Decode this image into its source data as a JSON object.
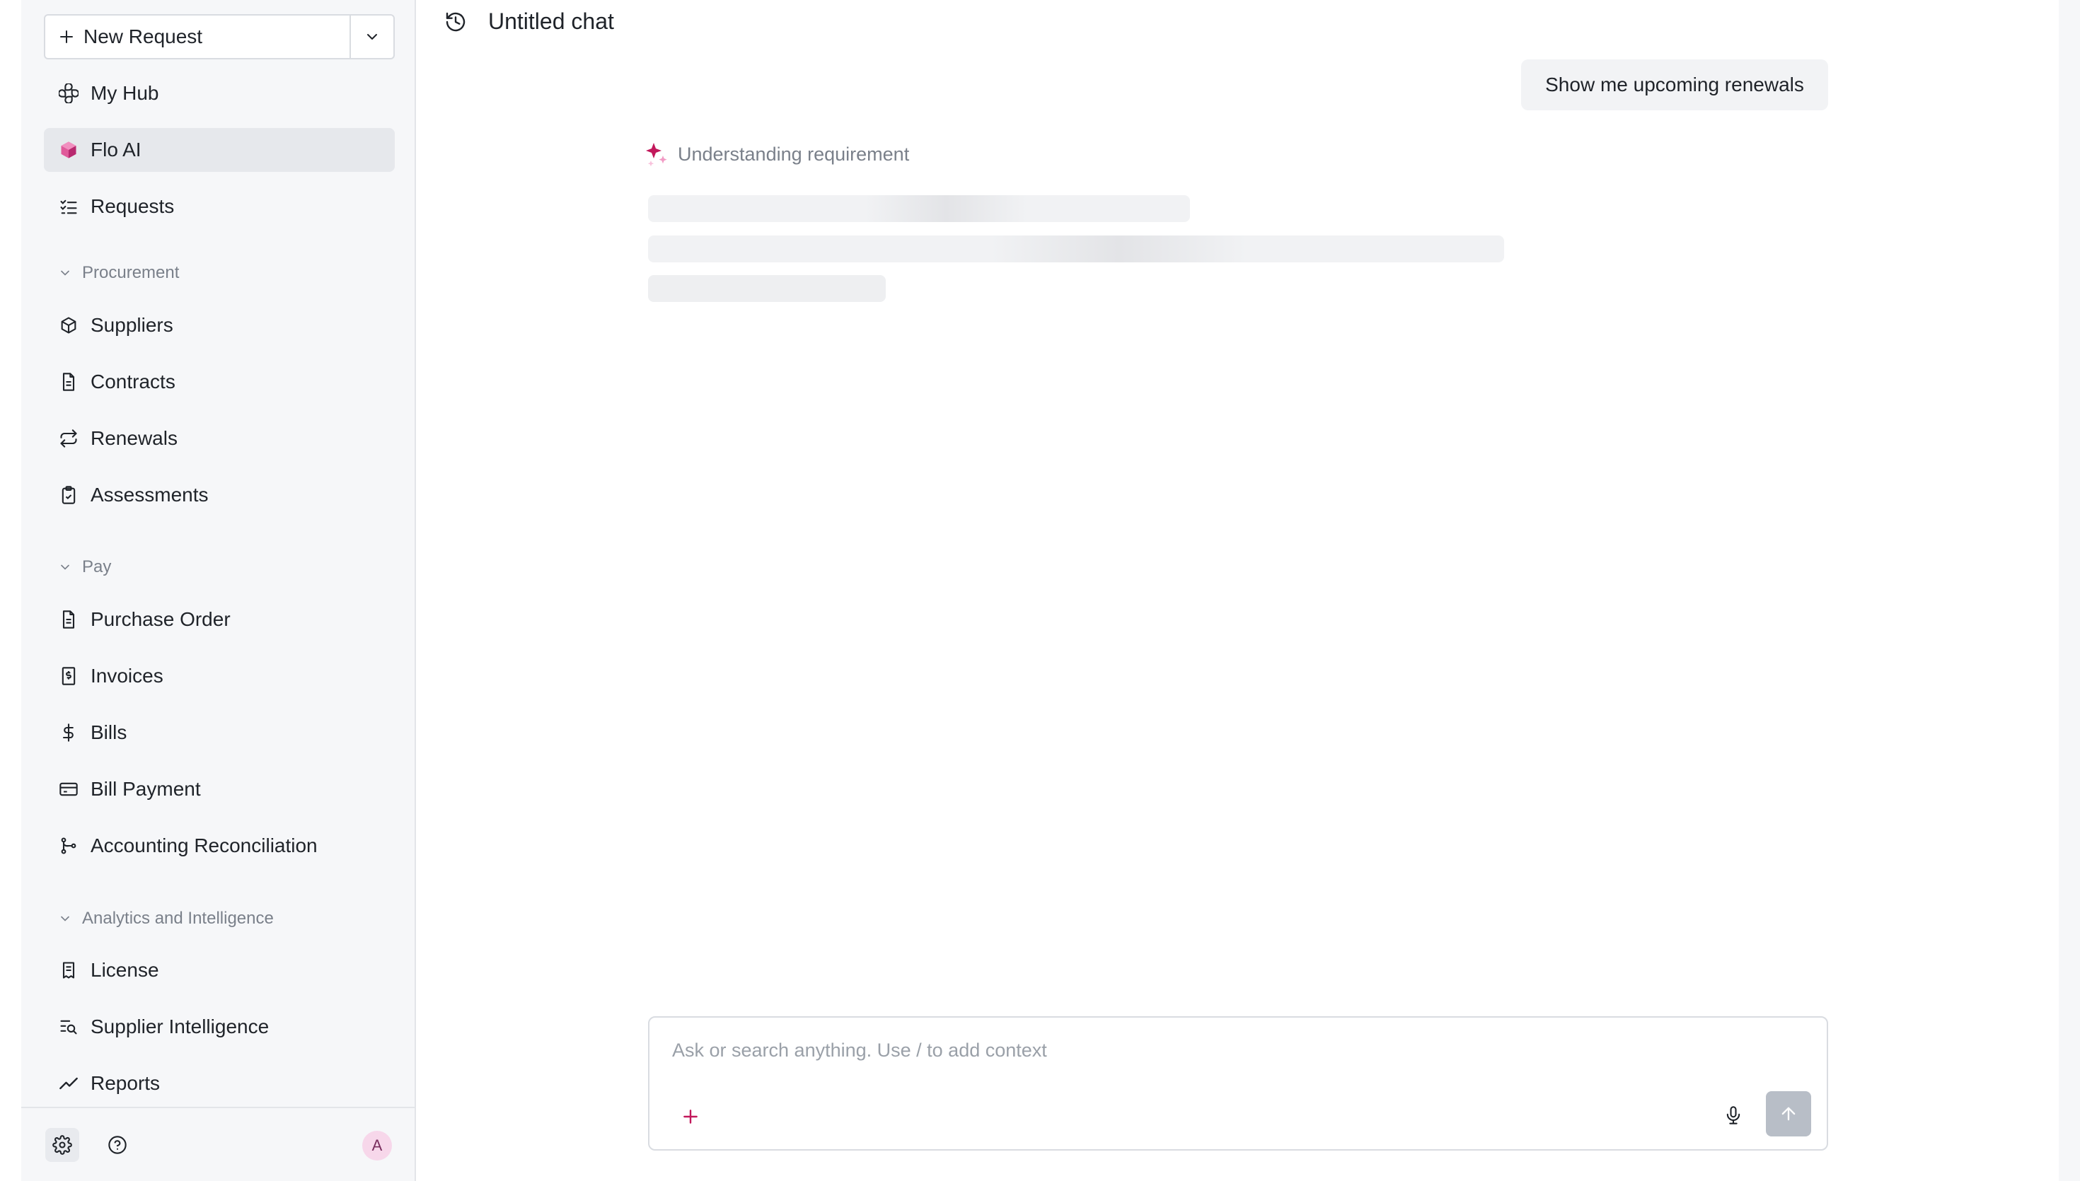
{
  "sidebar": {
    "new_request": {
      "label": "New Request"
    },
    "top_items": [
      {
        "label": "My Hub",
        "icon": "hub-icon"
      },
      {
        "label": "Flo AI",
        "icon": "flo-ai-logo-icon",
        "active": true
      },
      {
        "label": "Requests",
        "icon": "list-checks-icon"
      }
    ],
    "sections": [
      {
        "title": "Procurement",
        "items": [
          {
            "label": "Suppliers",
            "icon": "box-icon"
          },
          {
            "label": "Contracts",
            "icon": "document-icon"
          },
          {
            "label": "Renewals",
            "icon": "repeat-icon"
          },
          {
            "label": "Assessments",
            "icon": "clipboard-check-icon"
          }
        ]
      },
      {
        "title": "Pay",
        "items": [
          {
            "label": "Purchase Order",
            "icon": "document-icon"
          },
          {
            "label": "Invoices",
            "icon": "receipt-icon"
          },
          {
            "label": "Bills",
            "icon": "dollar-icon"
          },
          {
            "label": "Bill Payment",
            "icon": "credit-card-icon"
          },
          {
            "label": "Accounting Reconciliation",
            "icon": "git-branch-icon"
          }
        ]
      },
      {
        "title": "Analytics and Intelligence",
        "items": [
          {
            "label": "License",
            "icon": "license-icon"
          },
          {
            "label": "Supplier Intelligence",
            "icon": "search-list-icon"
          },
          {
            "label": "Reports",
            "icon": "trend-icon"
          }
        ]
      }
    ],
    "footer": {
      "avatar_initial": "A"
    }
  },
  "chat": {
    "title": "Untitled chat",
    "user_message": "Show me upcoming renewals",
    "status": "Understanding requirement",
    "composer": {
      "placeholder": "Ask or search anything. Use / to add context",
      "value": ""
    }
  },
  "colors": {
    "accent": "#c2185b",
    "sidebar_bg": "#f6f7f9",
    "active_item_bg": "#e6e8ec",
    "send_button_disabled": "#b8bec7"
  }
}
